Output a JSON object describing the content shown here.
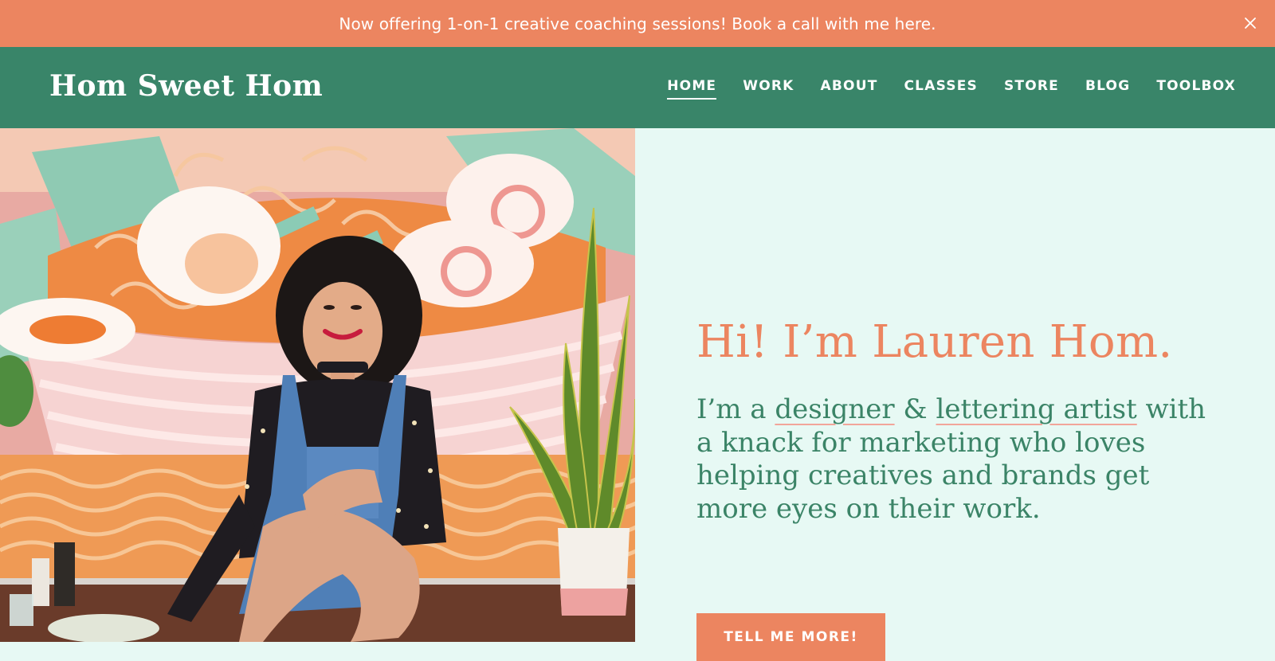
{
  "announcement": {
    "text": "Now offering 1-on-1 creative coaching sessions! Book a call with me here.",
    "close_icon": "close-icon"
  },
  "header": {
    "logo_text": "Hom Sweet Hom",
    "nav": [
      "HOME",
      "WORK",
      "ABOUT",
      "CLASSES",
      "STORE",
      "BLOG",
      "TOOLBOX"
    ],
    "active_nav": "HOME"
  },
  "intro": {
    "headline": "Hi! I’m Lauren Hom.",
    "bio_prefix": "I’m a ",
    "bio_highlight_1": "designer",
    "bio_mid": " & ",
    "bio_highlight_2": "lettering artist",
    "bio_suffix": " with a knack for marketing who loves helping creatives and brands get more eyes on their work.",
    "cta_label": "TELL ME MORE!"
  },
  "colors": {
    "announcement_bg": "#ec8560",
    "header_bg": "#398569",
    "page_bg": "#e7f9f4",
    "headline": "#ec8560",
    "body_text": "#3b8467",
    "button_bg": "#ec8560"
  }
}
